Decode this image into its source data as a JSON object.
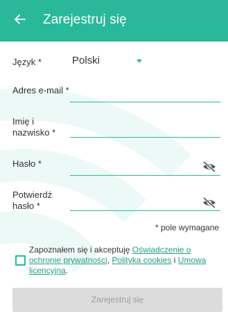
{
  "header": {
    "back_icon": "arrow-left-icon",
    "title": "Zarejestruj się",
    "color": "#29b99a"
  },
  "form": {
    "language": {
      "label": "Język *",
      "value": "Polski",
      "icon": "caret-down-icon"
    },
    "email": {
      "label": "Adres e-mail *",
      "value": ""
    },
    "name": {
      "label_line1": "Imię i",
      "label_line2": "nazwisko *",
      "value": ""
    },
    "password": {
      "label": "Hasło *",
      "value": "",
      "icon": "eye-off-icon"
    },
    "confirm_password": {
      "label_line1": "Potwierdź",
      "label_line2": "hasło *",
      "value": "",
      "icon": "eye-off-icon"
    },
    "required_note": "* pole wymagane",
    "consent": {
      "text1": "Zapoznałem się i akceptuję ",
      "link_privacy": "Oświadczenie o ochronie prywatności",
      "sep": ", ",
      "link_cookies": "Polityka cookies",
      "and": " i ",
      "link_license": "Umowa licencyjna",
      "end": ".",
      "checked": false
    },
    "submit_label": "Zarejestruj się"
  }
}
